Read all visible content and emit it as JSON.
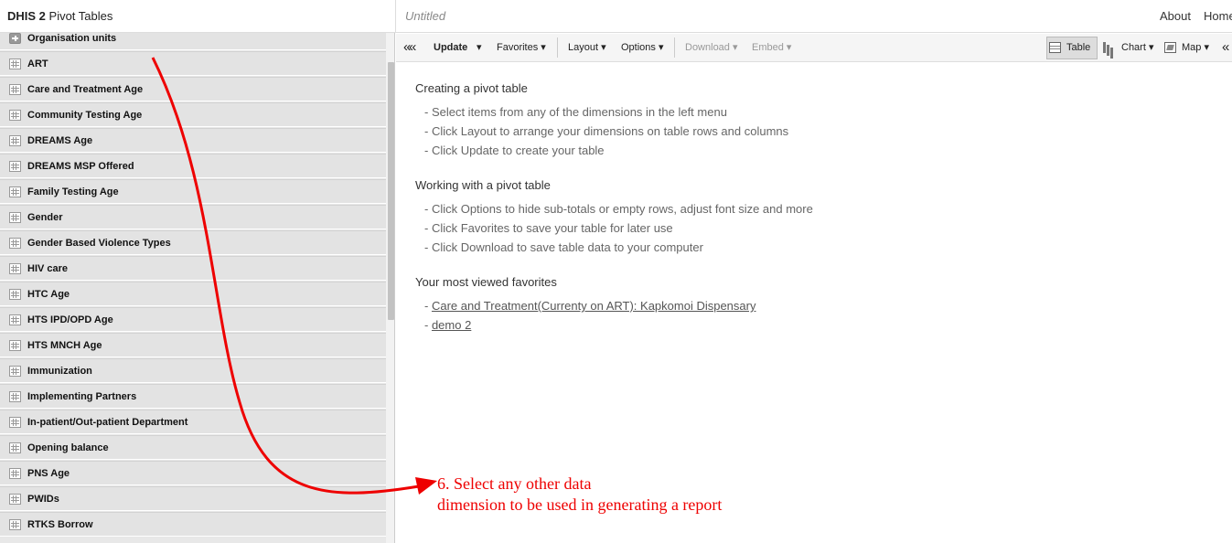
{
  "header": {
    "brand_bold": "DHIS 2",
    "brand_rest": " Pivot Tables",
    "favorite_title": "Untitled",
    "links": {
      "about": "About",
      "home": "Home"
    }
  },
  "sidebar": {
    "items": [
      {
        "label": "Organisation units",
        "icon": "plus-icon"
      },
      {
        "label": "ART",
        "icon": "grid-icon"
      },
      {
        "label": "Care and Treatment Age",
        "icon": "grid-icon"
      },
      {
        "label": "Community Testing Age",
        "icon": "grid-icon"
      },
      {
        "label": "DREAMS Age",
        "icon": "grid-icon"
      },
      {
        "label": "DREAMS MSP Offered",
        "icon": "grid-icon"
      },
      {
        "label": "Family Testing Age",
        "icon": "grid-icon"
      },
      {
        "label": "Gender",
        "icon": "grid-icon"
      },
      {
        "label": "Gender Based Violence Types",
        "icon": "grid-icon"
      },
      {
        "label": "HIV care",
        "icon": "grid-icon"
      },
      {
        "label": "HTC Age",
        "icon": "grid-icon"
      },
      {
        "label": "HTS IPD/OPD Age",
        "icon": "grid-icon"
      },
      {
        "label": "HTS MNCH Age",
        "icon": "grid-icon"
      },
      {
        "label": "Immunization",
        "icon": "grid-icon"
      },
      {
        "label": "Implementing Partners",
        "icon": "grid-icon"
      },
      {
        "label": "In-patient/Out-patient Department",
        "icon": "grid-icon"
      },
      {
        "label": "Opening balance",
        "icon": "grid-icon"
      },
      {
        "label": "PNS Age",
        "icon": "grid-icon"
      },
      {
        "label": "PWIDs",
        "icon": "grid-icon"
      },
      {
        "label": "RTKS Borrow",
        "icon": "grid-icon"
      }
    ]
  },
  "toolbar": {
    "collapse": "«",
    "update": "Update",
    "update_caret": "▾",
    "favorites": "Favorites ▾",
    "layout": "Layout ▾",
    "options": "Options ▾",
    "download": "Download ▾",
    "embed": "Embed ▾",
    "table": "Table",
    "chart": "Chart ▾",
    "map": "Map ▾",
    "expand": "«"
  },
  "content": {
    "sections": [
      {
        "title": "Creating a pivot table",
        "bullets": [
          "- Select items from any of the dimensions in the left menu",
          "- Click Layout to arrange your dimensions on table rows and columns",
          "- Click Update to create your table"
        ]
      },
      {
        "title": "Working with a pivot table",
        "bullets": [
          "- Click Options to hide sub-totals or empty rows, adjust font size and more",
          "- Click Favorites to save your table for later use",
          "- Click Download to save table data to your computer"
        ]
      }
    ],
    "favorites_title": "Your most viewed favorites",
    "favorites": [
      "Care and Treatment(Currenty on ART): Kapkomoi Dispensary",
      "demo 2"
    ],
    "bullet_prefix": "- "
  },
  "annotation": {
    "line1": "6. Select any other data",
    "line2": "dimension to be used in generating a report",
    "color": "#e00000"
  }
}
